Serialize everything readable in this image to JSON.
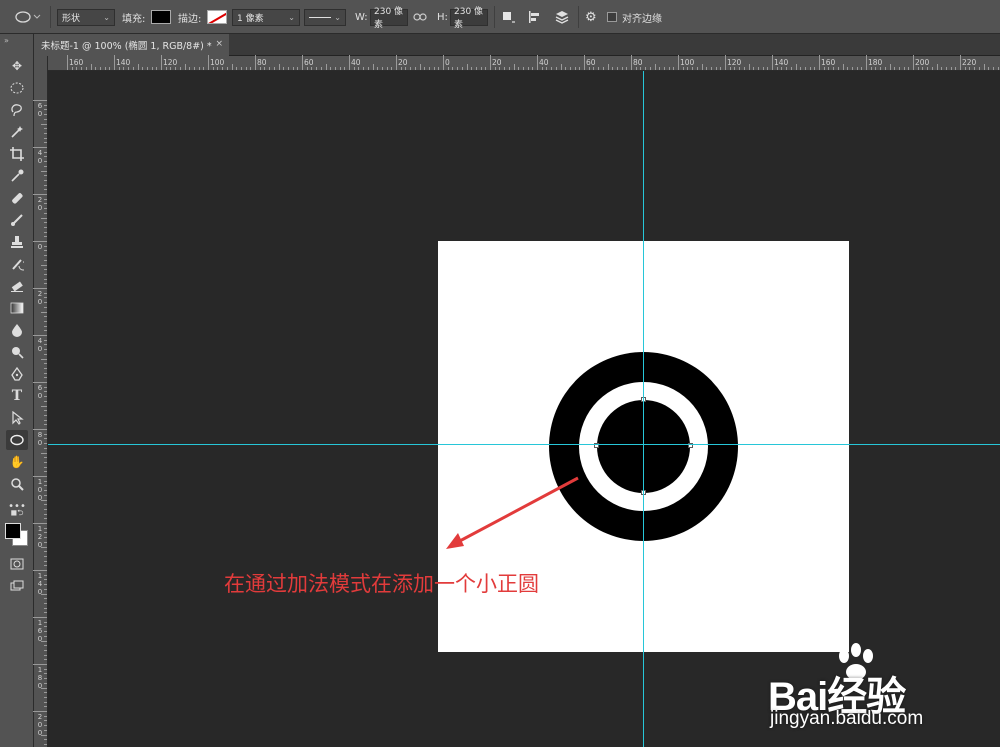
{
  "options_bar": {
    "tool_icon": "ellipse-tool-icon",
    "mode": "形状",
    "fill_label": "填充:",
    "fill_color": "#000000",
    "stroke_label": "描边:",
    "stroke_width": "1 像素",
    "width_label": "W:",
    "width_value": "230 像素",
    "height_label": "H:",
    "height_value": "230 像素",
    "align_edges_label": "对齐边缘"
  },
  "document_tab": {
    "title": "未标题-1 @ 100% (椭圆 1, RGB/8#) *",
    "close": "×"
  },
  "ruler_top": [
    "160",
    "140",
    "120",
    "100",
    "80",
    "60",
    "40",
    "20",
    "0",
    "20",
    "40",
    "60",
    "80",
    "100",
    "120",
    "140",
    "160",
    "180",
    "200",
    "220"
  ],
  "ruler_left": [
    "60",
    "40",
    "20",
    "0",
    "20",
    "40",
    "60",
    "80",
    "100",
    "120",
    "140",
    "160",
    "180",
    "200"
  ],
  "canvas": {
    "background": "#282828",
    "document_color": "#ffffff",
    "guide_color": "#27c6d8",
    "annotation": "在通过加法模式在添加一个小正圆",
    "annotation_color": "#e23b3b"
  },
  "watermark": {
    "logo_text": "Bai经验",
    "url": "jingyan.baidu.com"
  }
}
